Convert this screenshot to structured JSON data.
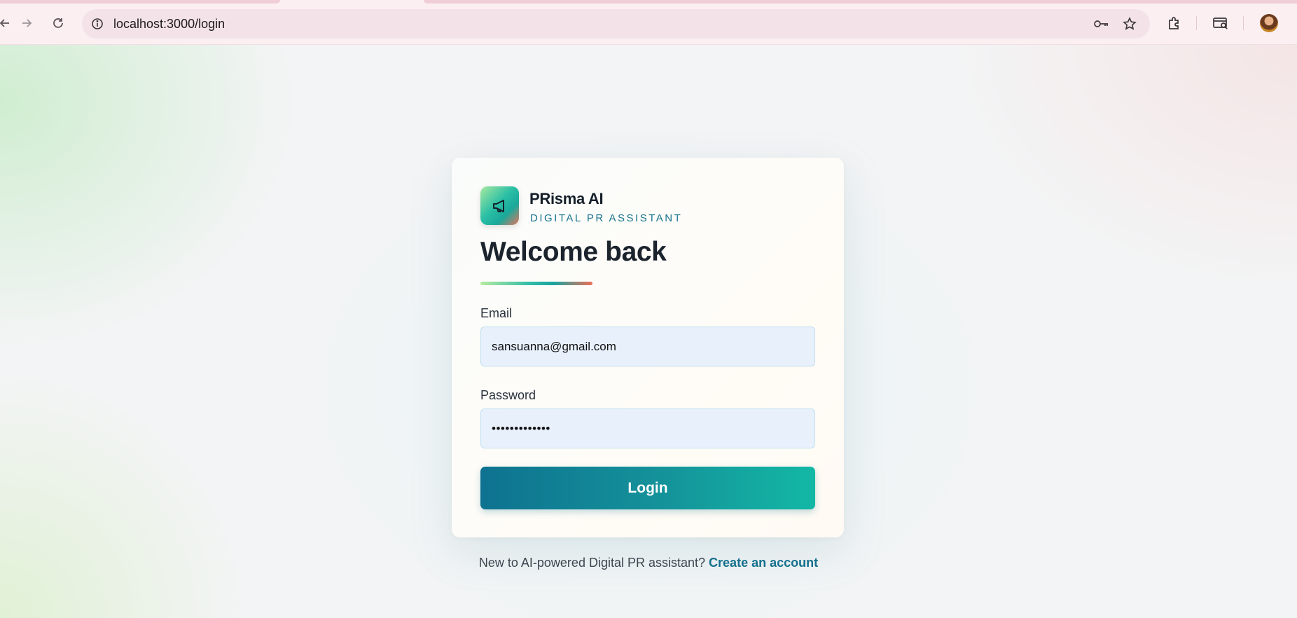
{
  "browser": {
    "url": "localhost:3000/login",
    "icons": [
      "back-icon",
      "forward-icon",
      "reload-icon",
      "site-info-icon",
      "key-icon",
      "star-icon",
      "extensions-icon",
      "tab-search-icon",
      "profile-avatar"
    ]
  },
  "brand": {
    "name": "PRisma AI",
    "tagline": "DIGITAL PR ASSISTANT",
    "logo_icon": "megaphone-icon"
  },
  "login": {
    "title": "Welcome back",
    "email_label": "Email",
    "email_value": "sansuanna@gmail.com",
    "password_label": "Password",
    "password_value": "•••••••••••••",
    "submit_label": "Login"
  },
  "signup": {
    "prompt": "New to AI-powered Digital PR assistant?",
    "link_label": "Create an account"
  },
  "colors": {
    "accent": "#136f8c",
    "button_start": "#0e7290",
    "button_end": "#13b8a5",
    "input_bg": "#e8f0fc"
  }
}
